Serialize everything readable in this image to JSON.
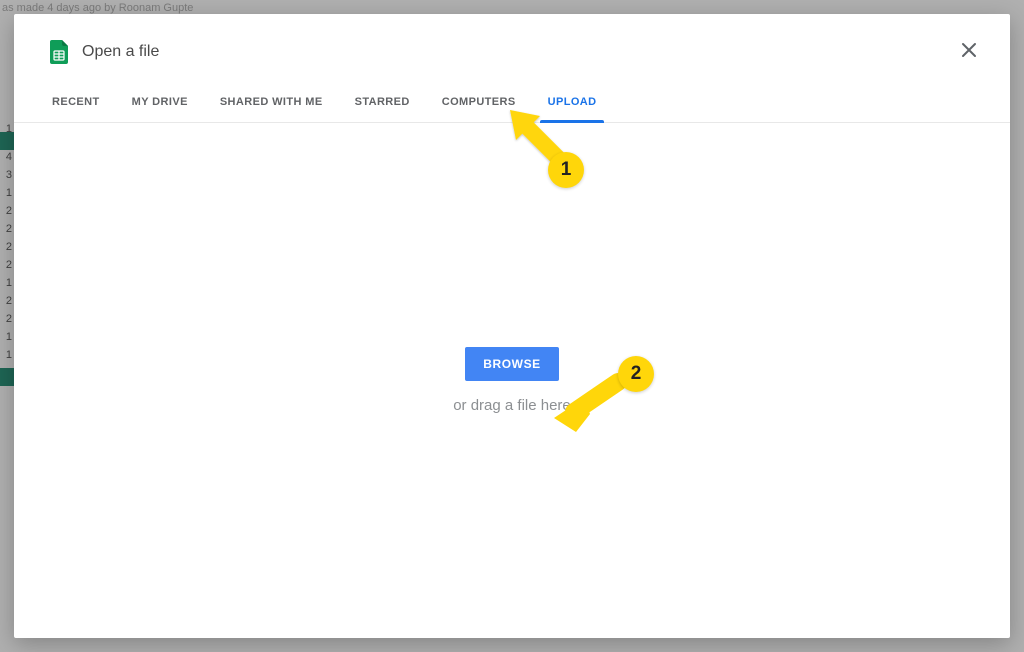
{
  "background_hint_text": "as made 4 days ago by Roonam Gupte",
  "row_labels": [
    "1",
    "4",
    "3",
    "1",
    "2",
    "2",
    "2",
    "2",
    "1",
    "2",
    "2",
    "1",
    "1"
  ],
  "dialog": {
    "title": "Open a file",
    "close_label": "Close"
  },
  "tabs": [
    {
      "label": "RECENT",
      "active": false
    },
    {
      "label": "MY DRIVE",
      "active": false
    },
    {
      "label": "SHARED WITH ME",
      "active": false
    },
    {
      "label": "STARRED",
      "active": false
    },
    {
      "label": "COMPUTERS",
      "active": false
    },
    {
      "label": "UPLOAD",
      "active": true
    }
  ],
  "upload": {
    "browse_label": "BROWSE",
    "drag_text": "or drag a file here"
  },
  "annotations": {
    "badge1": "1",
    "badge2": "2"
  },
  "colors": {
    "accent_blue": "#1a73e8",
    "button_blue": "#4285f4",
    "annotation_yellow": "#ffd60a"
  }
}
